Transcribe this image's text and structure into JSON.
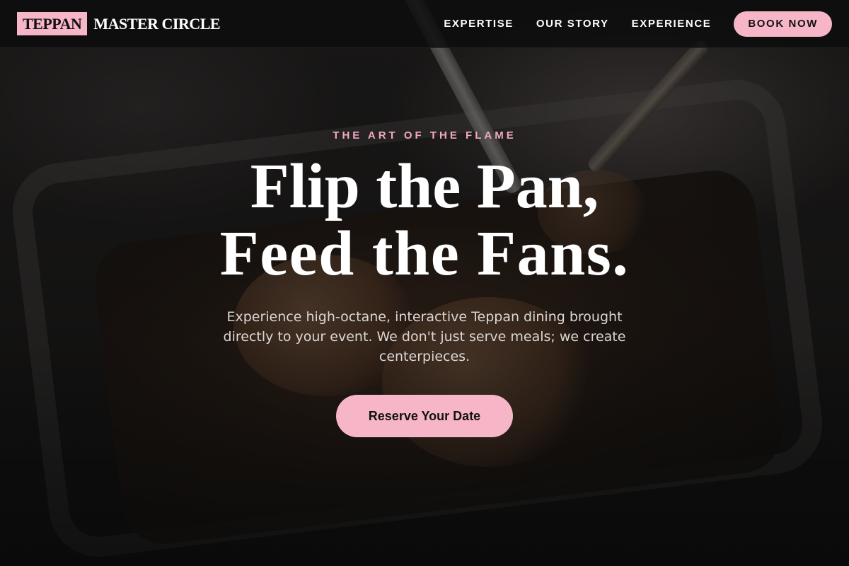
{
  "brand": {
    "logo_box_text": "TEPPAN",
    "logo_text": "MASTER CIRCLE",
    "accent_color": "#f7b6c8"
  },
  "nav": {
    "items": [
      {
        "label": "EXPERTISE"
      },
      {
        "label": "OUR STORY"
      },
      {
        "label": "EXPERIENCE"
      }
    ],
    "cta_label": "BOOK NOW"
  },
  "hero": {
    "eyebrow": "THE ART OF THE FLAME",
    "headline_line1": "Flip the Pan,",
    "headline_line2": "Feed the Fans.",
    "subtext": "Experience high-octane, interactive Teppan dining brought directly to your event. We don't just serve meals; we create centerpieces.",
    "cta_label": "Reserve Your Date"
  }
}
